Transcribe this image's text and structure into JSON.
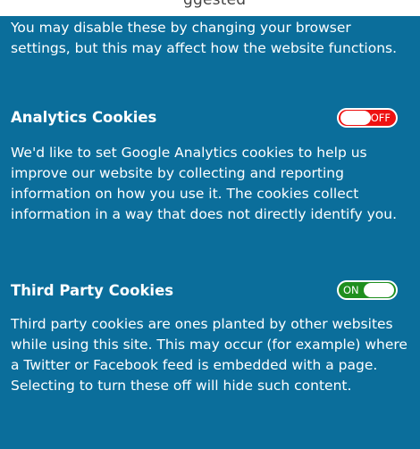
{
  "top_strip": {
    "partial_text": "ggested"
  },
  "intro_text": "You may disable these by changing your browser settings, but this may affect how the website functions.",
  "sections": [
    {
      "title": "Analytics Cookies",
      "toggle_state": "OFF",
      "toggle_color": "#ee1111",
      "description": "We'd like to set Google Analytics cookies to help us improve our website by collecting and reporting information on how you use it. The cookies collect information in a way that does not directly identify you."
    },
    {
      "title": "Third Party Cookies",
      "toggle_state": "ON",
      "toggle_color": "#1f8f1f",
      "description": "Third party cookies are ones planted by other websites while using this site. This may occur (for example) where a Twitter or Facebook feed is embedded with a page. Selecting to turn these off will hide such content."
    }
  ],
  "colors": {
    "panel_background": "#0b6e9b",
    "text": "#ffffff"
  }
}
